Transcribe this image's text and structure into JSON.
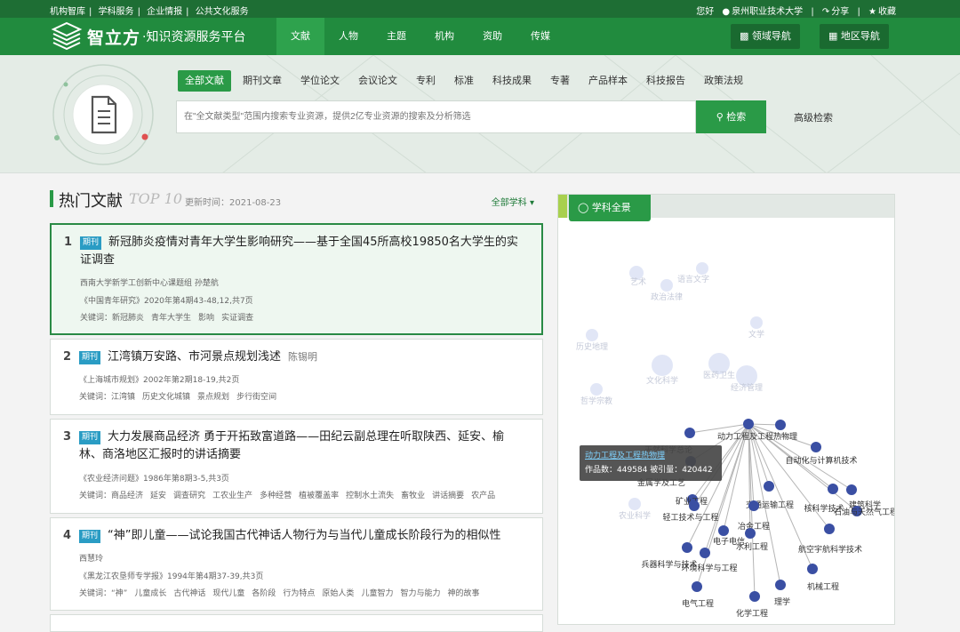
{
  "topbar": {
    "links": [
      "机构智库",
      "学科服务",
      "企业情报",
      "公共文化服务"
    ],
    "greeting": "您好",
    "user": "泉州职业技术大学",
    "share": "分享",
    "favorite": "收藏"
  },
  "logo": {
    "main": "智立方",
    "sub": "知识资源服务平台"
  },
  "nav": {
    "items": [
      "文献",
      "人物",
      "主题",
      "机构",
      "资助",
      "传媒"
    ],
    "active": "文献",
    "field_nav": "领域导航",
    "region_nav": "地区导航"
  },
  "search": {
    "tabs": [
      "全部文献",
      "期刊文章",
      "学位论文",
      "会议论文",
      "专利",
      "标准",
      "科技成果",
      "专著",
      "产品样本",
      "科技报告",
      "政策法规"
    ],
    "active_tab": "全部文献",
    "placeholder": "在\"全文献类型\"范围内搜索专业资源，提供2亿专业资源的搜索及分析筛选",
    "button": "检索",
    "advanced": "高级检索"
  },
  "hot": {
    "title": "热门文献",
    "top_label": "TOP 10",
    "updated": "更新时间：2021-08-23",
    "subject_filter": "全部学科",
    "items": [
      {
        "num": "1",
        "tag": "期刊",
        "title": "新冠肺炎疫情对青年大学生影响研究——基于全国45所高校19850名大学生的实证调查",
        "author": "",
        "authors_line": "西南大学新学工创新中心课题组   孙楚航",
        "source": "《中国青年研究》2020年第4期43-48,12,共7页",
        "kw_label": "关键词：",
        "keywords": [
          "新冠肺炎",
          "青年大学生",
          "影响",
          "实证调查"
        ]
      },
      {
        "num": "2",
        "tag": "期刊",
        "title": "江湾镇万安路、市河景点规划浅述",
        "author": "陈锡明",
        "authors_line": "",
        "source": "《上海城市规划》2002年第2期18-19,共2页",
        "kw_label": "关键词：",
        "keywords": [
          "江湾镇",
          "历史文化城镇",
          "景点规划",
          "步行街空间"
        ]
      },
      {
        "num": "3",
        "tag": "期刊",
        "title": "大力发展商品经济 勇于开拓致富道路——田纪云副总理在听取陕西、延安、榆林、商洛地区汇报时的讲话摘要",
        "author": "",
        "authors_line": "",
        "source": "《农业经济问题》1986年第8期3-5,共3页",
        "kw_label": "关键词：",
        "keywords": [
          "商品经济",
          "延安",
          "调查研究",
          "工农业生产",
          "多种经营",
          "植被覆盖率",
          "控制水土流失",
          "畜牧业",
          "讲话摘要",
          "农产品"
        ]
      },
      {
        "num": "4",
        "tag": "期刊",
        "title": "“神”即儿童——试论我国古代神话人物行为与当代儿童成长阶段行为的相似性",
        "author": "",
        "authors_line": "西慧玲",
        "source": "《黑龙江农垦师专学报》1994年第4期37-39,共3页",
        "kw_label": "关键词：",
        "keywords": [
          "“神”",
          "儿童成长",
          "古代神话",
          "现代儿童",
          "各阶段",
          "行为特点",
          "原始人类",
          "儿童智力",
          "智力与能力",
          "神的故事"
        ]
      }
    ]
  },
  "subject_panel": {
    "tab": "学科全景",
    "tooltip_title": "动力工程及工程热物理",
    "tooltip_stats": "作品数：449584 被引量：420442",
    "faded_labels": [
      "艺术",
      "语言文字",
      "政治法律",
      "文学",
      "历史地理",
      "文化科学",
      "医药卫生",
      "经济管理",
      "哲学宗教",
      "农业科学"
    ],
    "labels": [
      "天然科学总论",
      "动力工程及工程热物理",
      "自动化与计算机技术",
      "金属学及工艺",
      "矿业工程",
      "交通运输工程",
      "核科学技术",
      "建筑科学",
      "石油与天然气工程",
      "轻工技术与工程",
      "冶金工程",
      "电子电信",
      "水利工程",
      "航空宇航科学技术",
      "兵器科学与技术",
      "环境科学与工程",
      "机械工程",
      "理学",
      "电气工程",
      "化学工程"
    ],
    "colors": {
      "node": "#3a4fa3",
      "faded": "#c9d1ef",
      "link": "#b5b5b5",
      "accent": "#2a9a47"
    }
  }
}
